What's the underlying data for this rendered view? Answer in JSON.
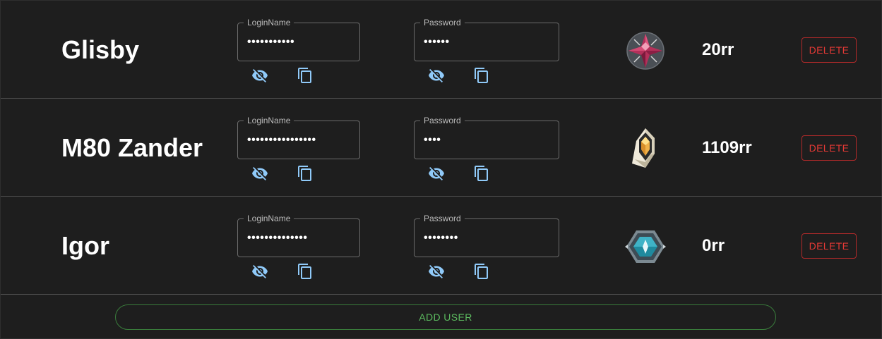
{
  "colors": {
    "background": "#1e1e1e",
    "icon_blue": "#90caf9",
    "delete_red": "#e53935",
    "add_green": "#5bb85e"
  },
  "users": [
    {
      "name": "Glisby",
      "login_label": "LoginName",
      "login_value": "•••••••••••",
      "password_label": "Password",
      "password_value": "••••••",
      "rank_icon": "immortal-rank-icon",
      "rr": "20rr",
      "delete_label": "DELETE"
    },
    {
      "name": "M80 Zander",
      "login_label": "LoginName",
      "login_value": "••••••••••••••••",
      "password_label": "Password",
      "password_value": "••••",
      "rank_icon": "radiant-rank-icon",
      "rr": "1109rr",
      "delete_label": "DELETE"
    },
    {
      "name": "Igor",
      "login_label": "LoginName",
      "login_value": "••••••••••••••",
      "password_label": "Password",
      "password_value": "••••••••",
      "rank_icon": "ascendant-rank-icon",
      "rr": "0rr",
      "delete_label": "DELETE"
    }
  ],
  "add_user_label": "ADD USER"
}
